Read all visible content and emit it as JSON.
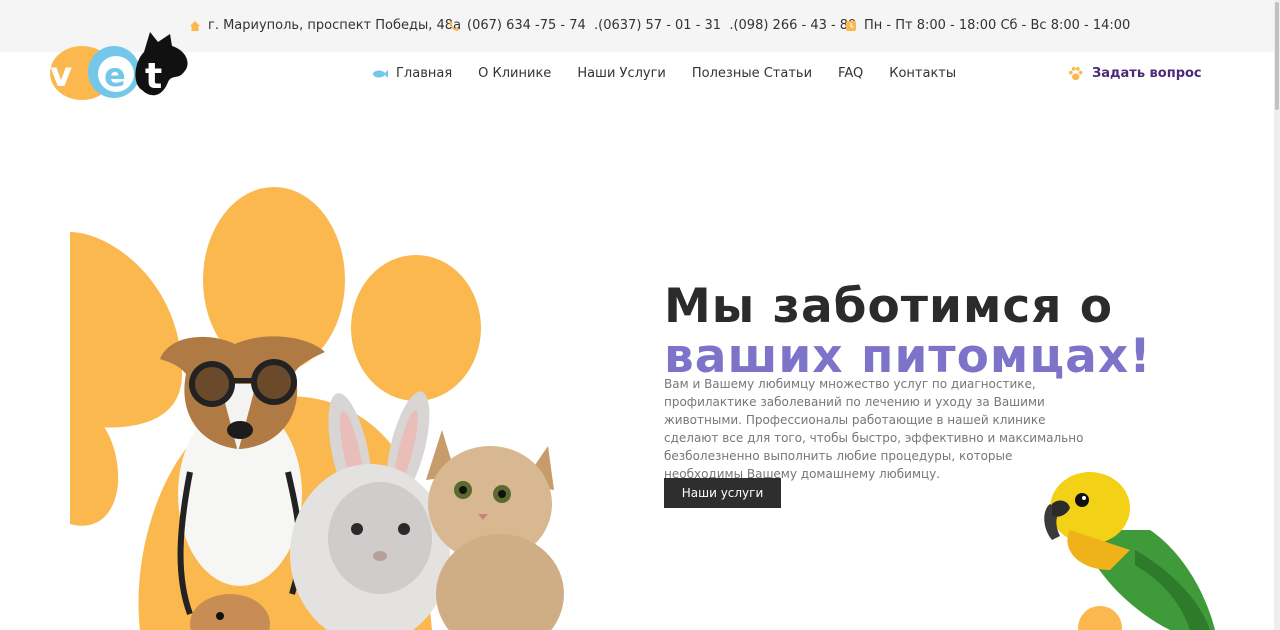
{
  "topbar": {
    "address": "г. Мариуполь, проспект Победы, 48а",
    "phones": "(067) 634 -75 - 74  .(0637) 57 - 01 - 31  .(098) 266 - 43 - 89",
    "hours": "Пн - Пт 8:00 - 18:00 Сб - Вс 8:00 - 14:00"
  },
  "logo": {
    "letter_v": "v",
    "letter_e": "e",
    "letter_t": "t"
  },
  "nav": {
    "items": [
      "Главная",
      "О Клинике",
      "Наши Услуги",
      "Полезные Статьи",
      "FAQ",
      "Контакты"
    ],
    "ask_label": "Задать вопрос"
  },
  "hero": {
    "title_line1": "Мы заботимся о",
    "title_line2": "ваших питомцах!",
    "description": "Вам и Вашему любимцу множество услуг по диагностике, профилактике заболеваний по лечению и уходу за Вашими животными. Профессионалы работающие в нашей клинике сделают все для того, чтобы быстро, эффективно и максимально безболезненно выполнить любие процедуры, которые необходимы Вашему домашнему любимцу.",
    "button_label": "Наши услуги"
  },
  "colors": {
    "accent_orange": "#fbb84f",
    "accent_purple": "#7d73c8",
    "dark": "#2e2e2e",
    "ask_purple": "#4b2a7a",
    "logo_blue": "#73c8ea"
  }
}
